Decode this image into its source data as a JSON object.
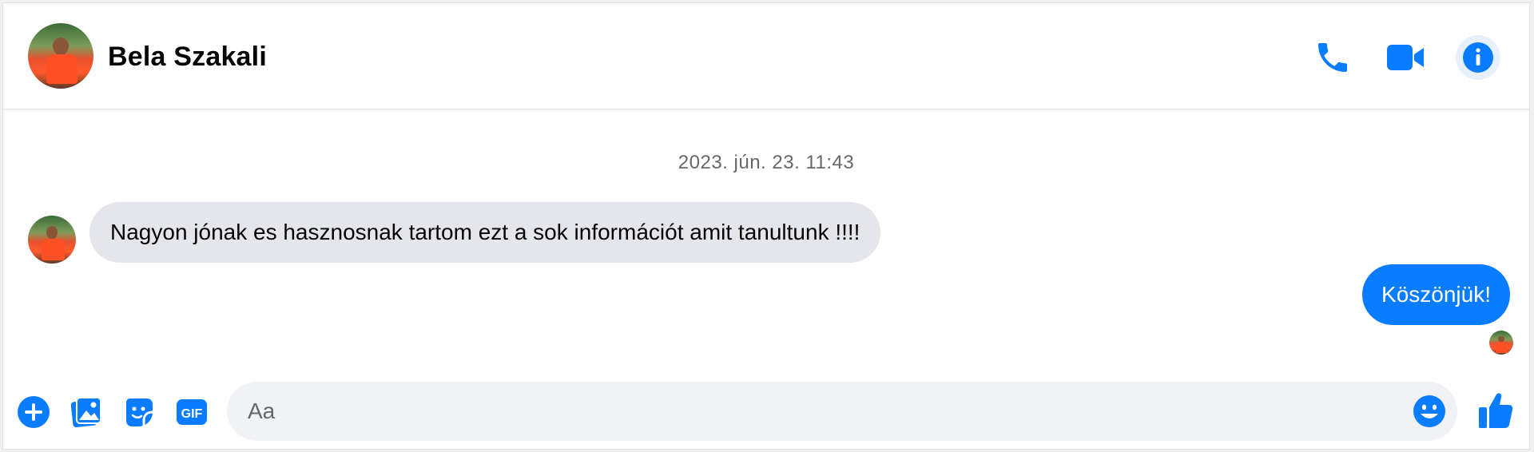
{
  "theme": {
    "accent": "#0a7cff",
    "incoming_bubble": "#e4e6eb",
    "muted_text": "#65676b"
  },
  "header": {
    "contact_name": "Bela Szakali",
    "actions": [
      {
        "icon": "phone-icon"
      },
      {
        "icon": "video-camera-icon"
      },
      {
        "icon": "info-icon"
      }
    ]
  },
  "conversation": {
    "timestamp": "2023. jún. 23. 11:43",
    "messages": [
      {
        "direction": "incoming",
        "text": "Nagyon jónak es hasznosnak tartom ezt a sok információt amit tanultunk !!!!"
      },
      {
        "direction": "outgoing",
        "text": "Köszönjük!"
      }
    ]
  },
  "composer": {
    "placeholder": "Aa",
    "value": "",
    "tools": [
      {
        "icon": "plus-icon"
      },
      {
        "icon": "photo-icon"
      },
      {
        "icon": "sticker-icon"
      },
      {
        "icon": "gif-icon",
        "label": "GIF"
      }
    ],
    "emoji_icon": "emoji-icon",
    "like_icon": "thumbs-up-icon"
  }
}
